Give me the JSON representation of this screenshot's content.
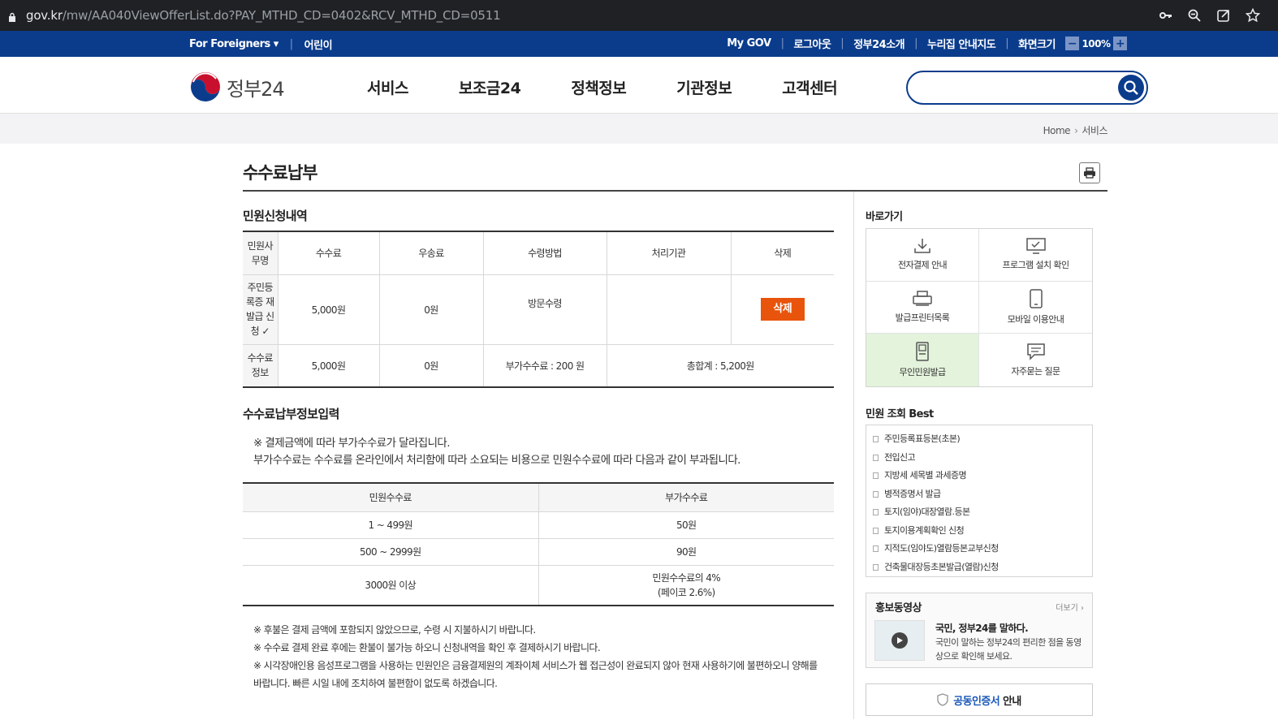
{
  "browser": {
    "url_domain": "gov.kr",
    "url_path": "/mw/AA040ViewOfferList.do?PAY_MTHD_CD=0402&RCV_MTHD_CD=0511"
  },
  "topbar": {
    "for_foreigners": "For Foreigners",
    "kids": "어린이",
    "mygov": "My GOV",
    "logout": "로그아웃",
    "intro": "정부24소개",
    "guide_map": "누리집 안내지도",
    "screen_size": "화면크기",
    "zoom": "100%"
  },
  "header": {
    "logo_text": "정부24",
    "nav": [
      "서비스",
      "보조금24",
      "정책정보",
      "기관정보",
      "고객센터"
    ],
    "search_placeholder": ""
  },
  "breadcrumb": {
    "home": "Home",
    "current": "서비스"
  },
  "page": {
    "title": "수수료납부"
  },
  "request": {
    "heading": "민원신청내역",
    "headers": [
      "민원사무명",
      "수수료",
      "우송료",
      "수령방법",
      "처리기관",
      "삭제"
    ],
    "row": {
      "name": "주민등록증 재발급 신청",
      "fee": "5,000원",
      "postage": "0원",
      "method": "방문수령",
      "agency": "",
      "delete_label": "삭제"
    },
    "fee_info": {
      "label": "수수료정보",
      "fee": "5,000원",
      "postage": "0원",
      "extra": "부가수수료 : 200 원",
      "total": "총합계 : 5,200원"
    }
  },
  "payment": {
    "heading": "수수료납부정보입력",
    "note1": "※ 결제금액에 따라 부가수수료가 달라집니다.",
    "note2": "부가수수료는 수수료를 온라인에서 처리함에 따라 소요되는 비용으로 민원수수료에 따라 다음과 같이 부과됩니다.",
    "headers": [
      "민원수수료",
      "부가수수료"
    ],
    "rows": [
      {
        "range": "1 ~ 499원",
        "fee": "50원",
        "fee2": ""
      },
      {
        "range": "500 ~ 2999원",
        "fee": "90원",
        "fee2": ""
      },
      {
        "range": "3000원 이상",
        "fee": "민원수수료의 4%",
        "fee2": "(페이코 2.6%)"
      }
    ],
    "footnotes": [
      "※ 후불은 결제 금액에 포함되지 않았으므로, 수령 시 지불하시기 바랍니다.",
      "※ 수수료 결제 완료 후에는 환불이 불가능 하오니 신청내역을 확인 후 결제하시기 바랍니다.",
      "※ 시각장애인용 음성프로그램을 사용하는 민원인은 금융결제원의 계좌이체 서비스가 웹 접근성이 완료되지 않아 현재 사용하기에 불편하오니 양해를 바랍니다. 빠른 시일 내에 조치하여 불편함이 없도록 하겠습니다."
    ]
  },
  "sidebar": {
    "quick_heading": "바로가기",
    "quick": [
      {
        "label": "전자결제 안내",
        "icon": "download-icon"
      },
      {
        "label": "프로그램 설치 확인",
        "icon": "monitor-check-icon"
      },
      {
        "label": "발급프린터목록",
        "icon": "printer-icon"
      },
      {
        "label": "모바일 이용안내",
        "icon": "mobile-icon"
      },
      {
        "label": "무인민원발급",
        "icon": "kiosk-icon"
      },
      {
        "label": "자주묻는 질문",
        "icon": "chat-icon"
      }
    ],
    "best_heading": "민원 조회 Best",
    "best": [
      "주민등록표등본(초본)",
      "전입신고",
      "지방세 세목별 과세증명",
      "병적증명서 발급",
      "토지(임야)대장열람.등본",
      "토지이용계획확인 신청",
      "지적도(임야도)열람등본교부신청",
      "건축물대장등초본발급(열람)신청"
    ],
    "promo": {
      "heading": "홍보동영상",
      "more": "더보기 ›",
      "title": "국민, 정부24를 말하다.",
      "desc": "국민이 말하는 정부24의 편리한 점을 동영상으로 확인해 보세요."
    },
    "cert": {
      "blue": "공동인증서",
      "rest": " 안내"
    }
  }
}
